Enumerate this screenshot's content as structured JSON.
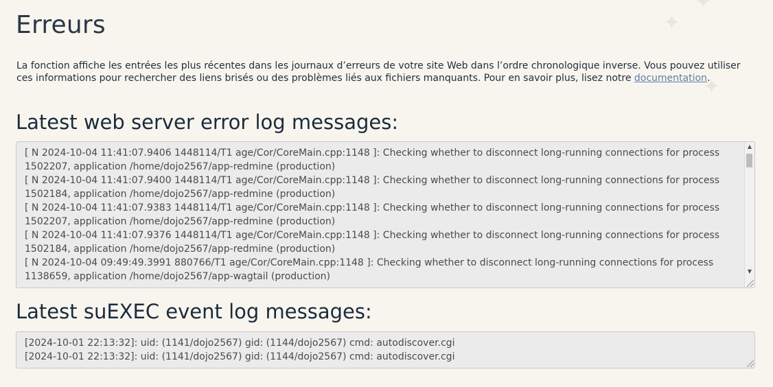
{
  "page": {
    "title": "Erreurs",
    "intro": {
      "text": "La fonction affiche les entrées les plus récentes dans les journaux d’erreurs de votre site Web dans l’ordre chronologique inverse. Vous pouvez utiliser ces informations pour rechercher des liens brisés ou des problèmes liés aux fichiers manquants. Pour en savoir plus, lisez notre ",
      "link_label": "documentation",
      "suffix": "."
    }
  },
  "web_log": {
    "title": "Latest web server error log messages:",
    "lines": [
      "[ N 2024-10-04 11:41:07.9406 1448114/T1 age/Cor/CoreMain.cpp:1148 ]: Checking whether to disconnect long-running connections for process 1502207, application /home/dojo2567/app-redmine (production)",
      "[ N 2024-10-04 11:41:07.9400 1448114/T1 age/Cor/CoreMain.cpp:1148 ]: Checking whether to disconnect long-running connections for process 1502184, application /home/dojo2567/app-redmine (production)",
      "[ N 2024-10-04 11:41:07.9383 1448114/T1 age/Cor/CoreMain.cpp:1148 ]: Checking whether to disconnect long-running connections for process 1502207, application /home/dojo2567/app-redmine (production)",
      "[ N 2024-10-04 11:41:07.9376 1448114/T1 age/Cor/CoreMain.cpp:1148 ]: Checking whether to disconnect long-running connections for process 1502184, application /home/dojo2567/app-redmine (production)",
      "[ N 2024-10-04 09:49:49.3991 880766/T1 age/Cor/CoreMain.cpp:1148 ]: Checking whether to disconnect long-running connections for process 1138659, application /home/dojo2567/app-wagtail (production)"
    ]
  },
  "suexec_log": {
    "title": "Latest suEXEC event log messages:",
    "lines": [
      "[2024-10-01 22:13:32]: uid: (1141/dojo2567) gid: (1144/dojo2567) cmd: autodiscover.cgi",
      "[2024-10-01 22:13:32]: uid: (1141/dojo2567) gid: (1144/dojo2567) cmd: autodiscover.cgi"
    ]
  },
  "icons": {
    "scroll_up": "scroll-up-arrow-icon",
    "scroll_down": "scroll-down-arrow-icon",
    "resize": "resize-grip-icon",
    "decoration": "sparkle-icon"
  },
  "colors": {
    "background": "#f8f5ee",
    "heading": "#1a2b3c",
    "link": "#5d7fa6",
    "log_background": "#ebebeb",
    "log_text": "#4a4a4a"
  }
}
